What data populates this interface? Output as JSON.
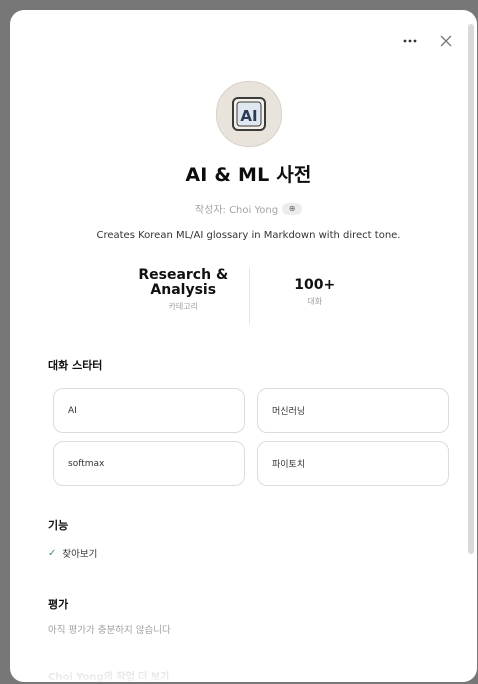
{
  "topbar": {
    "more_icon": "ellipsis-icon",
    "close_icon": "close-icon"
  },
  "gpt": {
    "title": "AI & ML 사전",
    "author_prefix": "작성자: Choi Yong",
    "description": "Creates Korean ML/AI glossary in Markdown with direct tone.",
    "avatar_text": "AI"
  },
  "stats": [
    {
      "value": "Research &\nAnalysis",
      "label": "카테고리"
    },
    {
      "value": "100+",
      "label": "대화"
    }
  ],
  "starters": {
    "title": "대화 스타터",
    "items": [
      "AI",
      "머신러닝",
      "softmax",
      "파이토치"
    ]
  },
  "features": {
    "title": "기능",
    "items": [
      "찾아보기"
    ]
  },
  "ratings": {
    "title": "평가",
    "text": "아직 평가가 충분하지 않습니다"
  },
  "more": {
    "label": "Choi Yong의 작업 더 보기"
  },
  "colors": {
    "check": "#3a9a5b",
    "backdrop": "#777777"
  }
}
